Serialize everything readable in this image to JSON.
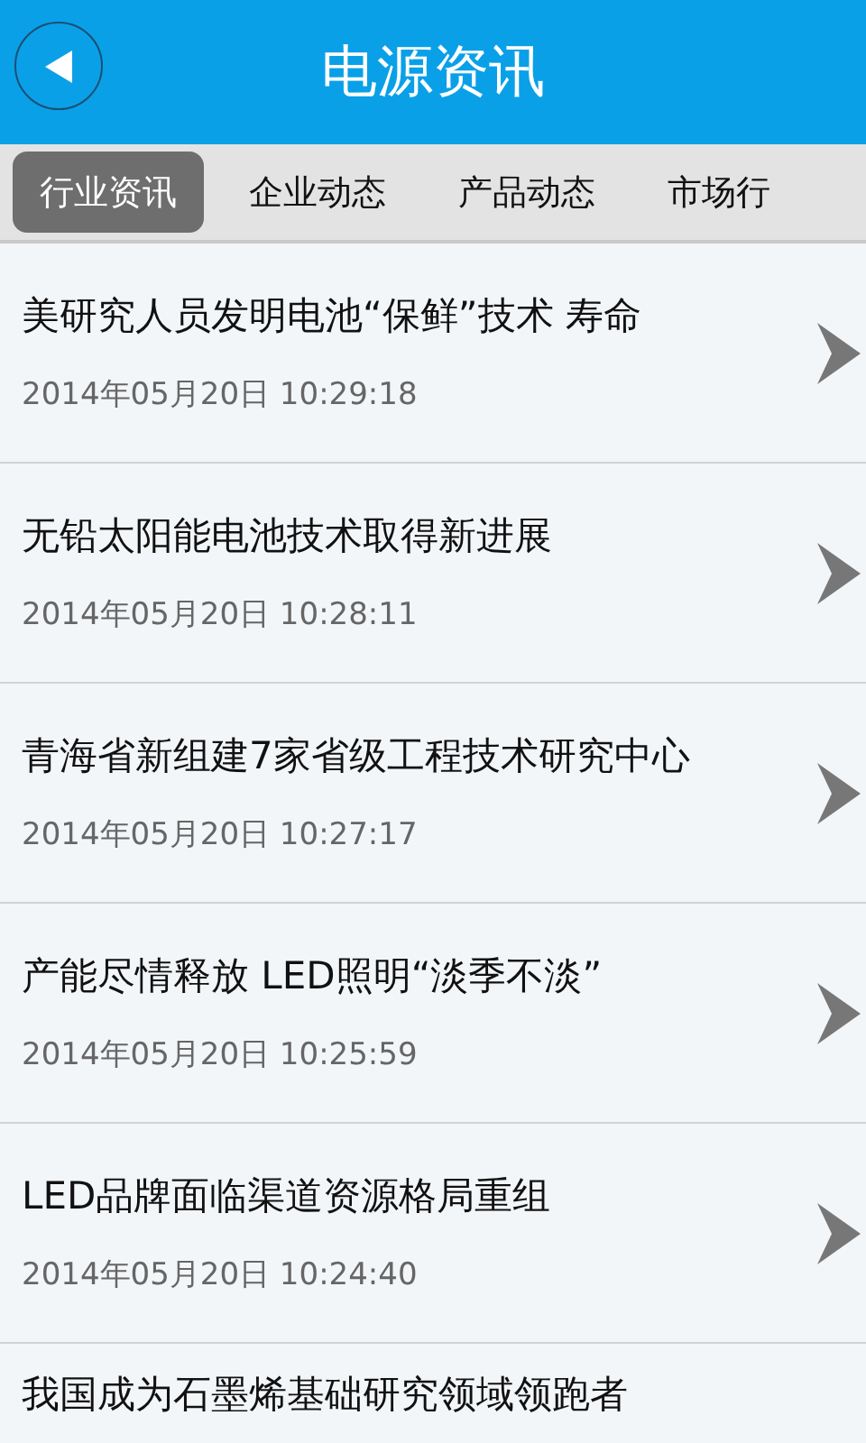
{
  "header": {
    "title": "电源资讯"
  },
  "tabs": [
    {
      "label": "行业资讯",
      "selected": true
    },
    {
      "label": "企业动态",
      "selected": false
    },
    {
      "label": "产品动态",
      "selected": false
    },
    {
      "label": "市场行",
      "selected": false
    }
  ],
  "news": [
    {
      "title": "美研究人员发明电池“保鲜”技术 寿命",
      "date": "2014年05月20日 10:29:18"
    },
    {
      "title": "无铅太阳能电池技术取得新进展",
      "date": "2014年05月20日 10:28:11"
    },
    {
      "title": "青海省新组建7家省级工程技术研究中心",
      "date": "2014年05月20日 10:27:17"
    },
    {
      "title": "产能尽情释放 LED照明“淡季不淡”",
      "date": "2014年05月20日 10:25:59"
    },
    {
      "title": "LED品牌面临渠道资源格局重组",
      "date": "2014年05月20日 10:24:40"
    },
    {
      "title": "我国成为石墨烯基础研究领域领跑者"
    }
  ]
}
